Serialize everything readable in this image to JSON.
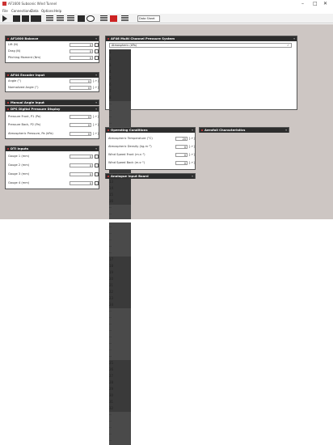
{
  "window": {
    "title": "AF1600 Subsonic Wind Tunnel",
    "min": "–",
    "max": "□",
    "close": "✕"
  },
  "menu": [
    "File",
    "Connections",
    "Data",
    "Options",
    "Help"
  ],
  "toolbar": {
    "dropdown": "Data Sheet"
  },
  "panels": {
    "balance": {
      "title": "AF1600 Balance",
      "rows": [
        {
          "label": "Lift (N)",
          "value": "0"
        },
        {
          "label": "Drag (N)",
          "value": "0"
        },
        {
          "label": "Pitching Moment (Nm)",
          "value": "0"
        }
      ]
    },
    "encoder": {
      "title": "AF44 Encoder Input",
      "rows": [
        {
          "label": "Angle (°)",
          "value": "0",
          "unit": "[-+]"
        },
        {
          "label": "Normalized Angle (°)",
          "value": "0",
          "unit": "[-+]"
        }
      ]
    },
    "manual": {
      "title": "Manual Angle Input"
    },
    "dpd": {
      "title": "DPS Digital Pressure Display",
      "rows": [
        {
          "label": "Pressure Front, P1 (Pa)",
          "value": "0",
          "unit": "[-+]"
        },
        {
          "label": "Pressure Back, P2 (Pa)",
          "value": "0",
          "unit": "[-+]"
        },
        {
          "label": "Atmospheric Pressure, Pa (kPa)",
          "value": "0",
          "unit": "[-+]"
        }
      ]
    },
    "dti": {
      "title": "DTI Inputs",
      "rows": [
        {
          "label": "Gauge 1 (mm)",
          "value": "0"
        },
        {
          "label": "Gauge 2 (mm)",
          "value": "0"
        },
        {
          "label": "Gauge 3 (mm)",
          "value": "0"
        },
        {
          "label": "Gauge 4 (mm)",
          "value": "0"
        }
      ]
    },
    "multichannel": {
      "title": "AF46 Multi Channel Pressure System",
      "subtitle": "Atmospheric (kPa)",
      "check": "✓",
      "headers": [
        "1",
        "2",
        "3",
        "4",
        "5",
        "6",
        "7",
        "8"
      ],
      "rowsA": [
        "--",
        "--",
        "--",
        "--",
        "--",
        "--",
        "--",
        "--"
      ],
      "headers2": [
        "9",
        "10",
        "11",
        "12",
        "13",
        "14",
        "15",
        "16"
      ],
      "headers3": [
        "17",
        "18",
        "19",
        "20",
        "21",
        "22",
        "23",
        "24"
      ],
      "headers4": [
        "25",
        "26",
        "27",
        "28",
        "29",
        "30",
        "31",
        "32"
      ]
    },
    "opcond": {
      "title": "Operating Conditions",
      "rows": [
        {
          "label": "Atmospheric Temperature (°C)",
          "value": "20",
          "unit": "[-+]"
        },
        {
          "label": "Atmospheric Density (kg.m⁻³)",
          "value": "0",
          "unit": "[-+]"
        },
        {
          "label": "Wind Speed Front (m.s⁻¹)",
          "value": "0",
          "unit": "[-+]"
        },
        {
          "label": "Wind Speed Back (m.s⁻¹)",
          "value": "0",
          "unit": "[-+]"
        }
      ]
    },
    "airfoil": {
      "title": "Aerofoil Characteristics"
    },
    "analogue": {
      "title": "Analogue Input Board"
    }
  }
}
